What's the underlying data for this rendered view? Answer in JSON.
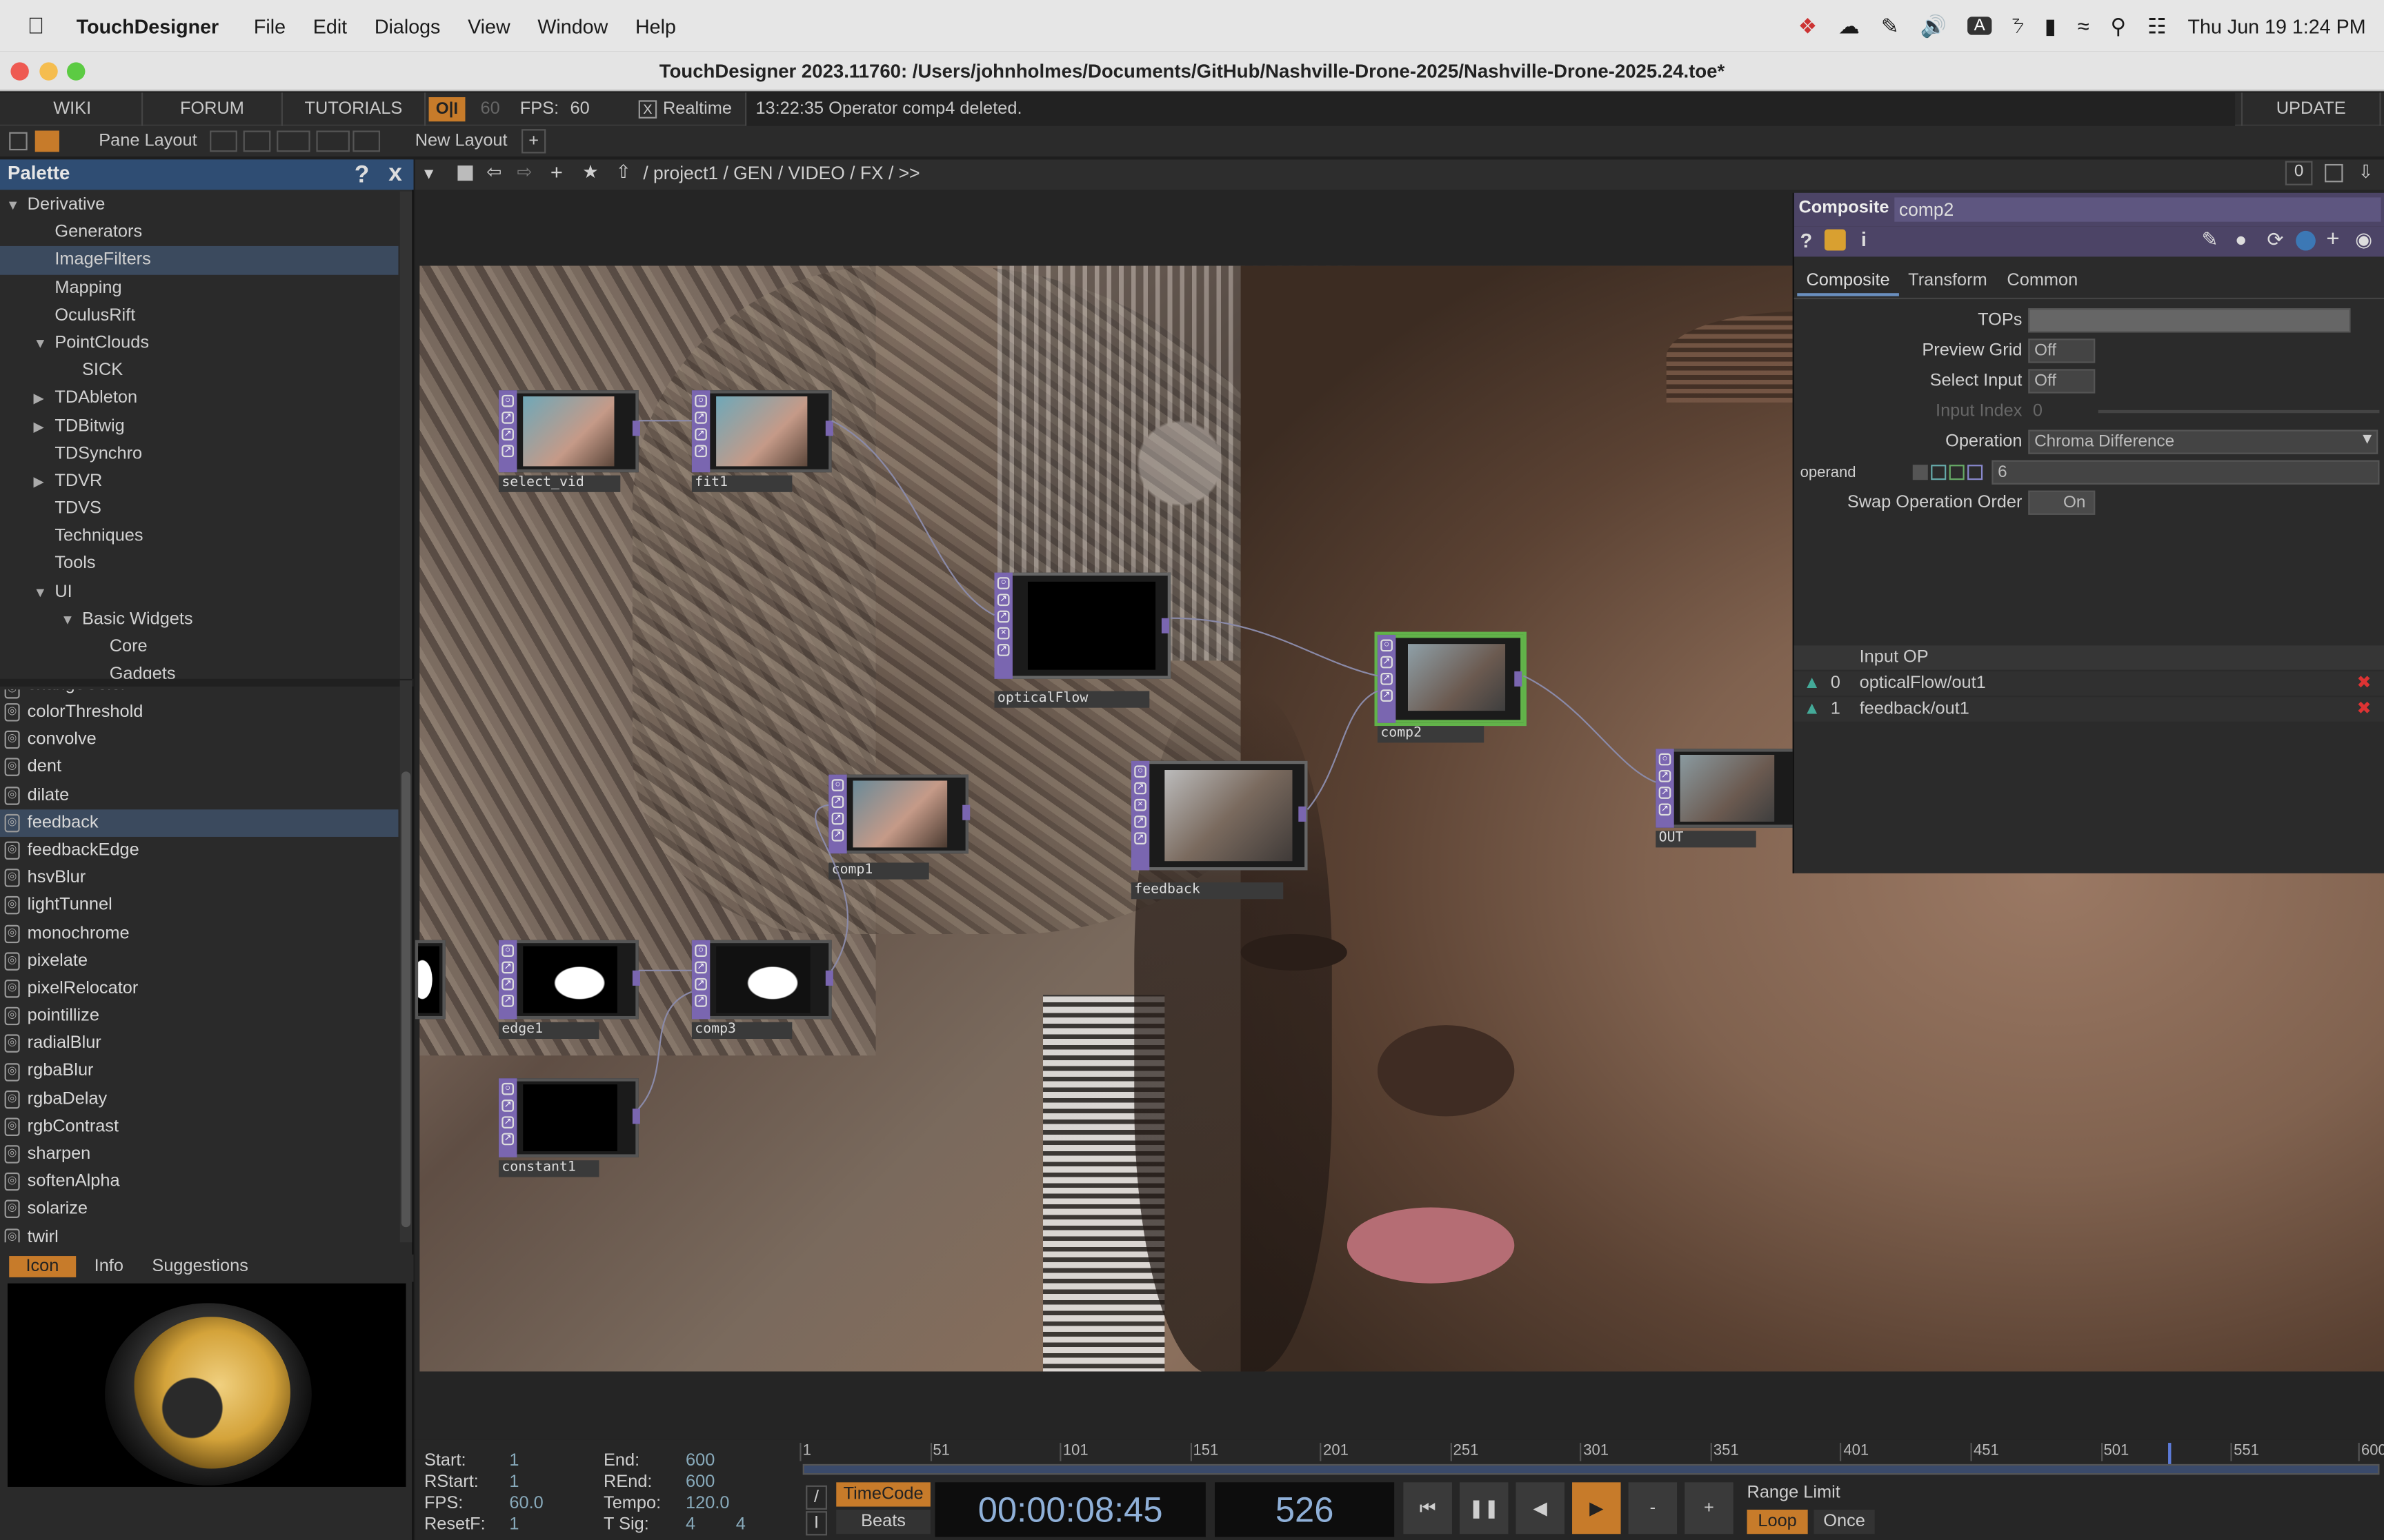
{
  "menubar": {
    "app": "TouchDesigner",
    "items": [
      "File",
      "Edit",
      "Dialogs",
      "View",
      "Window",
      "Help"
    ],
    "datetime": "Thu Jun 19  1:24 PM",
    "input_badge": "A"
  },
  "window": {
    "title": "TouchDesigner 2023.11760: /Users/johnholmes/Documents/GitHub/Nashville-Drone-2025/Nashville-Drone-2025.24.toe*"
  },
  "toolbar": {
    "wiki": "WIKI",
    "forum": "FORUM",
    "tutorials": "TUTORIALS",
    "oi": "O|I",
    "fps_dim": "60",
    "fps_label": "FPS:",
    "fps_value": "60",
    "realtime_check": "X",
    "realtime": "Realtime",
    "status": "13:22:35 Operator comp4 deleted.",
    "update": "UPDATE"
  },
  "layoutbar": {
    "pane_layout": "Pane Layout",
    "new_layout": "New Layout",
    "plus": "+"
  },
  "palette": {
    "title": "Palette",
    "help": "?",
    "close": "x",
    "tree": [
      {
        "label": "Derivative",
        "level": 0,
        "arrow": "▼"
      },
      {
        "label": "Generators",
        "level": 1,
        "arrow": ""
      },
      {
        "label": "ImageFilters",
        "level": 1,
        "arrow": "",
        "selected": true
      },
      {
        "label": "Mapping",
        "level": 1,
        "arrow": ""
      },
      {
        "label": "OculusRift",
        "level": 1,
        "arrow": ""
      },
      {
        "label": "PointClouds",
        "level": 1,
        "arrow": "▼"
      },
      {
        "label": "SICK",
        "level": 2,
        "arrow": ""
      },
      {
        "label": "TDAbleton",
        "level": 1,
        "arrow": "▶"
      },
      {
        "label": "TDBitwig",
        "level": 1,
        "arrow": "▶"
      },
      {
        "label": "TDSynchro",
        "level": 1,
        "arrow": ""
      },
      {
        "label": "TDVR",
        "level": 1,
        "arrow": "▶"
      },
      {
        "label": "TDVS",
        "level": 1,
        "arrow": ""
      },
      {
        "label": "Techniques",
        "level": 1,
        "arrow": ""
      },
      {
        "label": "Tools",
        "level": 1,
        "arrow": ""
      },
      {
        "label": "UI",
        "level": 1,
        "arrow": "▼"
      },
      {
        "label": "Basic Widgets",
        "level": 2,
        "arrow": "▼"
      },
      {
        "label": "Core",
        "level": 3,
        "arrow": ""
      },
      {
        "label": "Gadgets",
        "level": 3,
        "arrow": ""
      }
    ],
    "components": [
      {
        "label": "changeColor"
      },
      {
        "label": "colorThreshold"
      },
      {
        "label": "convolve"
      },
      {
        "label": "dent"
      },
      {
        "label": "dilate"
      },
      {
        "label": "feedback",
        "selected": true
      },
      {
        "label": "feedbackEdge"
      },
      {
        "label": "hsvBlur"
      },
      {
        "label": "lightTunnel"
      },
      {
        "label": "monochrome"
      },
      {
        "label": "pixelate"
      },
      {
        "label": "pixelRelocator"
      },
      {
        "label": "pointillize"
      },
      {
        "label": "radialBlur"
      },
      {
        "label": "rgbaBlur"
      },
      {
        "label": "rgbaDelay"
      },
      {
        "label": "rgbContrast"
      },
      {
        "label": "sharpen"
      },
      {
        "label": "softenAlpha"
      },
      {
        "label": "solarize"
      },
      {
        "label": "twirl"
      }
    ],
    "tabs": {
      "icon": "Icon",
      "info": "Info",
      "suggestions": "Suggestions"
    }
  },
  "network": {
    "path": "/ project1 / GEN / VIDEO / FX / >>",
    "counter": "0",
    "nodes": {
      "select_vid": "select_vid",
      "fit1": "fit1",
      "opticalFlow": "opticalFlow",
      "comp2": "comp2",
      "comp1": "comp1",
      "feedback": "feedback",
      "out": "OUT",
      "edge1": "edge1",
      "comp3": "comp3",
      "constant1": "constant1"
    }
  },
  "params": {
    "optype": "Composite",
    "opname": "comp2",
    "tabs": [
      "Composite",
      "Transform",
      "Common"
    ],
    "tops": "TOPs",
    "preview_grid": "Preview Grid",
    "preview_grid_val": "Off",
    "select_input": "Select Input",
    "select_input_val": "Off",
    "input_index": "Input Index",
    "input_index_val": "0",
    "operation": "Operation",
    "operation_val": "Chroma Difference",
    "operand": "operand",
    "operand_val": "6",
    "swap": "Swap Operation Order",
    "swap_val": "On",
    "input_op_header": "Input OP",
    "inputs": [
      {
        "idx": "0",
        "name": "opticalFlow/out1"
      },
      {
        "idx": "1",
        "name": "feedback/out1"
      }
    ]
  },
  "timeline": {
    "start_l": "Start:",
    "start": "1",
    "rstart_l": "RStart:",
    "rstart": "1",
    "fps_l": "FPS:",
    "fps": "60.0",
    "resetf_l": "ResetF:",
    "resetf": "1",
    "end_l": "End:",
    "end": "600",
    "rend_l": "REnd:",
    "rend": "600",
    "tempo_l": "Tempo:",
    "tempo": "120.0",
    "tsig_l": "T Sig:",
    "tsig_a": "4",
    "tsig_b": "4",
    "ruler": [
      "1",
      "51",
      "101",
      "151",
      "201",
      "251",
      "301",
      "351",
      "401",
      "451",
      "501",
      "551",
      "600"
    ],
    "timecode_btn": "TimeCode",
    "beats_btn": "Beats",
    "timecode": "00:00:08:45",
    "frame": "526",
    "range_limit": "Range Limit",
    "loop": "Loop",
    "once": "Once",
    "minus": "-",
    "plus": "+",
    "playhead_frame": 526
  }
}
